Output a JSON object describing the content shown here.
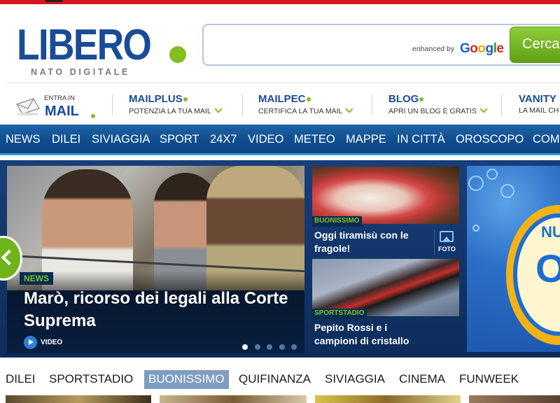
{
  "logo": {
    "wordmark": "LIBERO",
    "tagline": "NATO DIGITALE"
  },
  "search": {
    "value": "",
    "placeholder": "",
    "enhanced_by": "enhanced by",
    "google_letters": [
      "G",
      "o",
      "o",
      "g",
      "l",
      "e"
    ],
    "button_label": "Cerca"
  },
  "services": {
    "mail": {
      "small": "ENTRA IN",
      "big": "MAIL"
    },
    "items": [
      {
        "title": "MAILPLUS",
        "sub": "POTENZIA LA TUA MAIL"
      },
      {
        "title": "MAILPEC",
        "sub": "CERTIFICA LA TUA MAIL"
      },
      {
        "title": "BLOG",
        "sub": "APRI UN BLOG È GRATIS"
      },
      {
        "title": "VANITY",
        "sub": "LA MAIL CH"
      }
    ]
  },
  "nav": [
    "NEWS",
    "DILEI",
    "SIVIAGGIA",
    "SPORT",
    "24X7",
    "VIDEO",
    "METEO",
    "MAPPE",
    "IN CITTÀ",
    "OROSCOPO",
    "COM"
  ],
  "hero": {
    "main": {
      "tag": "NEWS",
      "headline": "Marò, ricorso dei legali alla Corte Suprema",
      "video_label": "VIDEO"
    },
    "slides_total": 5,
    "slide_active": 1,
    "cards": [
      {
        "tag": "BUONISSIMO",
        "text": "Oggi tiramisù con le fragole!",
        "foto_label": "FOTO"
      },
      {
        "tag": "SPORTSTADIO",
        "text": "Pepito Rossi e i campioni di cristallo"
      }
    ],
    "ad": {
      "partial_text": "NU",
      "big_letter": "O"
    }
  },
  "categories": {
    "items": [
      "DILEI",
      "SPORTSTADIO",
      "BUONISSIMO",
      "QUIFINANZA",
      "SIVIAGGIA",
      "CINEMA",
      "FUNWEEK"
    ],
    "active": "BUONISSIMO"
  },
  "colors": {
    "brand_blue": "#1a4b97",
    "brand_green": "#86bd1e",
    "nav_blue": "#0e4c8c",
    "active_tab": "#7f9cc2"
  }
}
